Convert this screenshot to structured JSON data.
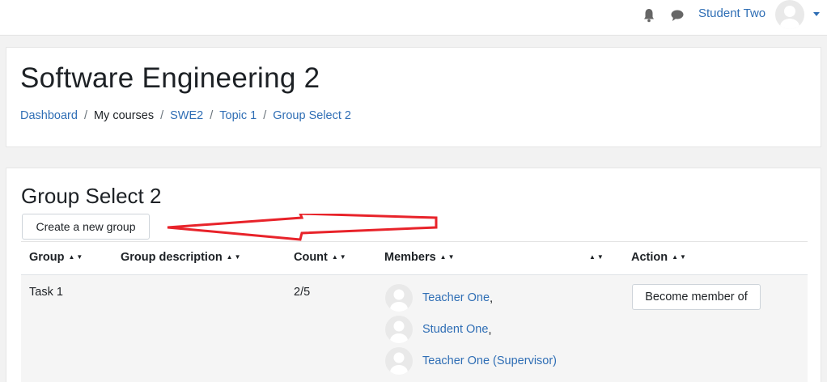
{
  "navbar": {
    "user_name": "Student Two"
  },
  "header": {
    "title": "Software Engineering 2",
    "breadcrumb": [
      {
        "label": "Dashboard",
        "link": true
      },
      {
        "label": "My courses",
        "link": false
      },
      {
        "label": "SWE2",
        "link": true
      },
      {
        "label": "Topic 1",
        "link": true
      },
      {
        "label": "Group Select 2",
        "link": true
      }
    ],
    "separator": "/"
  },
  "main": {
    "title": "Group Select 2",
    "create_button": "Create a new group",
    "annotation_color": "#e8232a",
    "table": {
      "columns": [
        "Group",
        "Group description",
        "Count",
        "Members",
        "",
        "Action"
      ],
      "sort_glyph": "▲▼",
      "rows": [
        {
          "group": "Task 1",
          "description": "",
          "count": "2/5",
          "members": [
            {
              "name": "Teacher One",
              "suffix": ","
            },
            {
              "name": "Student One",
              "suffix": ","
            },
            {
              "name": "Teacher One (Supervisor)",
              "suffix": ""
            }
          ],
          "action": "Become member of"
        }
      ]
    }
  },
  "colors": {
    "link": "#2f6eb5",
    "text": "#1d2125",
    "page_bg": "#f2f2f2",
    "row_bg": "#f5f5f5"
  }
}
